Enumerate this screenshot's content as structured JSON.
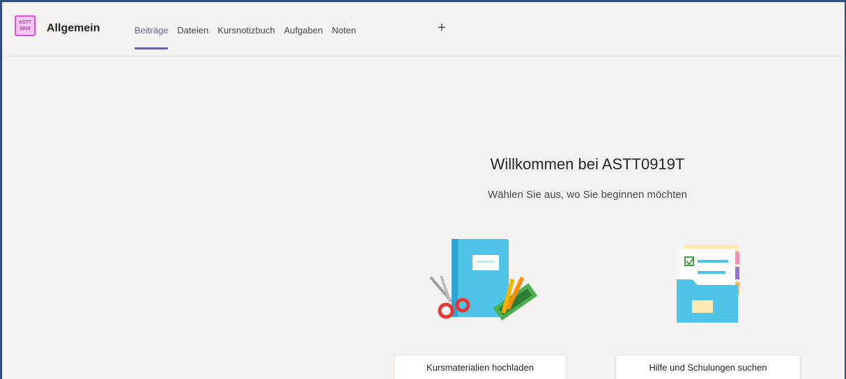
{
  "team": {
    "icon_line1": "ASTT",
    "icon_line2": "0919",
    "channel_name": "Allgemein"
  },
  "tabs": [
    {
      "label": "Beiträge",
      "active": true
    },
    {
      "label": "Dateien",
      "active": false
    },
    {
      "label": "Kursnotizbuch",
      "active": false
    },
    {
      "label": "Aufgaben",
      "active": false
    },
    {
      "label": "Noten",
      "active": false
    }
  ],
  "add_tab_glyph": "+",
  "welcome": {
    "title": "Willkommen bei ASTT0919T",
    "subtitle": "Wählen Sie aus, wo Sie beginnen möchten"
  },
  "actions": {
    "upload_label": "Kursmaterialien hochladen",
    "help_label": "Hilfe und Schulungen suchen"
  },
  "colors": {
    "accent": "#6264a7",
    "team_icon": "#d84fd8"
  }
}
